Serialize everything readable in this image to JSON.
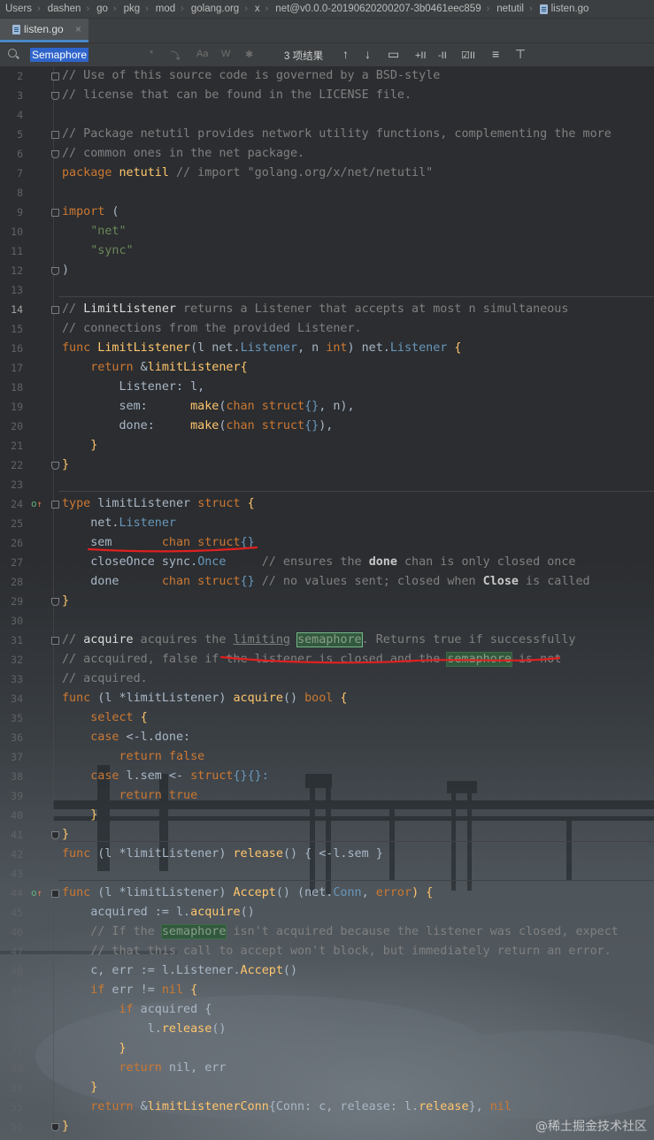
{
  "breadcrumb": [
    "Users",
    "dashen",
    "go",
    "pkg",
    "mod",
    "golang.org",
    "x",
    "net@v0.0.0-20190620200207-3b0461eec859",
    "netutil",
    "listen.go"
  ],
  "tab": {
    "label": "listen.go",
    "close": "×"
  },
  "search": {
    "query": "Semaphore",
    "options": [
      "*",
      "⤵",
      "Aa",
      "W",
      "✱"
    ],
    "result_count": "3 项结果",
    "tools": [
      "↑",
      "↓",
      "▭",
      "+II",
      "-II",
      "☑II",
      "≡",
      "⊤"
    ]
  },
  "editor": {
    "line_numbers": [
      "2",
      "3",
      "4",
      "5",
      "6",
      "7",
      "8",
      "9",
      "10",
      "11",
      "12",
      "13",
      "14",
      "15",
      "16",
      "17",
      "18",
      "19",
      "20",
      "21",
      "22",
      "23",
      "24",
      "25",
      "26",
      "27",
      "28",
      "29",
      "30",
      "31",
      "32",
      "33",
      "34",
      "35",
      "36",
      "37",
      "38",
      "39",
      "40",
      "41",
      "42",
      "43",
      "44",
      "45",
      "46",
      "47",
      "48",
      "49",
      "50",
      "51",
      "52",
      "53",
      "54",
      "55",
      "56"
    ],
    "current_line": "14",
    "lines": {
      "l2": "// Use of this source code is governed by a BSD-style",
      "l3": "// license that can be found in the LICENSE file.",
      "l5": "// Package netutil provides network utility functions, complementing the more",
      "l6": "// common ones in the net package.",
      "l7_kw": "package",
      "l7_name": " netutil",
      "l7_com": " // import \"golang.org/x/net/netutil\"",
      "l9_kw": "import",
      "l9_rest": " (",
      "l10": "    \"net\"",
      "l11": "    \"sync\"",
      "l12": ")",
      "l14_a": "// ",
      "l14_b": "LimitListener",
      "l14_c": " returns a Listener that accepts at most n simultaneous",
      "l15": "// connections from the provided Listener.",
      "l16_kw": "func",
      "l16_fn": " LimitListener",
      "l16_a": "(l net.",
      "l16_b": "Listener",
      "l16_c": ", n ",
      "l16_d": "int",
      "l16_e": ") net.",
      "l16_f": "Listener",
      "l16_g": " {",
      "l17_a": "    ",
      "l17_kw": "return",
      "l17_b": " &",
      "l17_fn": "limitListener",
      "l17_c": "{",
      "l18": "        Listener: l,",
      "l19_a": "        sem:      ",
      "l19_fn": "make",
      "l19_b": "(",
      "l19_kw": "chan struct",
      "l19_c": "{}",
      "l19_d": ", n),",
      "l20_a": "        done:     ",
      "l20_fn": "make",
      "l20_b": "(",
      "l20_kw": "chan struct",
      "l20_c": "{}",
      "l20_d": "),",
      "l21": "    }",
      "l22": "}",
      "l24_kw": "type",
      "l24_a": " limitListener ",
      "l24_kw2": "struct",
      "l24_b": " {",
      "l25_a": "    net.",
      "l25_b": "Listener",
      "l26_a": "    sem       ",
      "l26_kw": "chan struct",
      "l26_b": "{}",
      "l27_a": "    closeOnce sync.",
      "l27_b": "Once",
      "l27_com": "     // ensures the ",
      "l27_bold": "done",
      "l27_com2": " chan is only closed once",
      "l28_a": "    done      ",
      "l28_kw": "chan struct",
      "l28_b": "{}",
      "l28_com": " // no values sent; closed when ",
      "l28_bold": "Close",
      "l28_com2": " is called",
      "l29": "}",
      "l31_a": "// ",
      "l31_b": "acquire",
      "l31_c": " acquires the ",
      "l31_d": "limiting",
      "l31_e": " ",
      "l31_f": "semaphore",
      "l31_g": ". Returns true if successfully",
      "l32_a": "// accquired, false if the listener is closed and the ",
      "l32_f": "semaphore",
      "l32_g": " is not",
      "l33": "// acquired.",
      "l34_kw": "func",
      "l34_a": " (l *",
      "l34_b": "limitListener",
      "l34_c": ") ",
      "l34_fn": "acquire",
      "l34_d": "() ",
      "l34_kw2": "bool",
      "l34_e": " {",
      "l35_a": "    ",
      "l35_kw": "select",
      "l35_b": " {",
      "l36_a": "    ",
      "l36_kw": "case",
      "l36_b": " <-l.done:",
      "l37_a": "        ",
      "l37_kw": "return false",
      "l38_a": "    ",
      "l38_kw": "case",
      "l38_b": " l.sem <- ",
      "l38_kw2": "struct",
      "l38_c": "{}{}:",
      "l39_a": "        ",
      "l39_kw": "return true",
      "l40": "    }",
      "l41": "}",
      "l42_kw": "func",
      "l42_a": " (l *",
      "l42_b": "limitListener",
      "l42_c": ") ",
      "l42_fn": "release",
      "l42_d": "() { <-l.sem }",
      "l44_kw": "func",
      "l44_a": " (l *",
      "l44_b": "limitListener",
      "l44_c": ") ",
      "l44_fn": "Accept",
      "l44_d": "() (net.",
      "l44_e": "Conn",
      "l44_f": ", ",
      "l44_kw2": "error",
      "l44_g": ") {",
      "l45_a": "    acquired := l.",
      "l45_fn": "acquire",
      "l45_b": "()",
      "l46_a": "    // If the ",
      "l46_f": "semaphore",
      "l46_g": " isn't acquired because the listener was closed, expect",
      "l47": "    // that this call to accept won't block, but immediately return an error.",
      "l48_a": "    c, err := l.Listener.",
      "l48_fn": "Accept",
      "l48_b": "()",
      "l49_a": "    ",
      "l49_kw": "if",
      "l49_b": " err != ",
      "l49_kw2": "nil",
      "l49_c": " {",
      "l50_a": "        ",
      "l50_kw": "if",
      "l50_b": " acquired {",
      "l51_a": "            l.",
      "l51_fn": "release",
      "l51_b": "()",
      "l52": "        }",
      "l53_a": "        ",
      "l53_kw": "return",
      "l53_b": " nil, err",
      "l54": "    }",
      "l55_a": "    ",
      "l55_kw": "return",
      "l55_b": " &",
      "l55_fn": "limitListenerConn",
      "l55_c": "{Conn: c, release: l.",
      "l55_d": "release",
      "l55_e": "}, ",
      "l55_kw2": "nil",
      "l56": "}"
    }
  },
  "watermark": "@稀土掘金技术社区",
  "colors": {
    "keyword": "#cc7832",
    "string": "#6a8759",
    "function": "#ffc66d",
    "comment": "#808080",
    "annotation": "#e02020"
  }
}
